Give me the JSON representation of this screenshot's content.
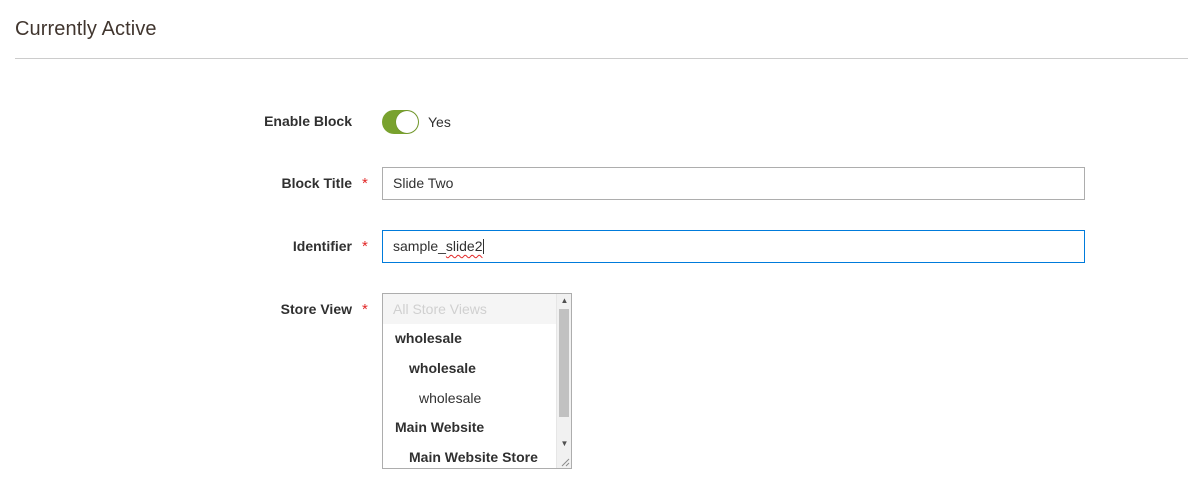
{
  "section": {
    "title": "Currently Active"
  },
  "fields": {
    "enable_block": {
      "label": "Enable Block",
      "value_text": "Yes",
      "enabled": true
    },
    "block_title": {
      "label": "Block Title",
      "required_mark": "*",
      "value": "Slide Two"
    },
    "identifier": {
      "label": "Identifier",
      "required_mark": "*",
      "value_prefix": "sample_",
      "value_misspelled": "slide2"
    },
    "store_view": {
      "label": "Store View",
      "required_mark": "*",
      "options": [
        {
          "label": "All Store Views",
          "disabled": true
        },
        {
          "label": "wholesale"
        },
        {
          "label": "wholesale"
        },
        {
          "label": "wholesale"
        },
        {
          "label": "Main Website"
        },
        {
          "label": "Main Website Store"
        }
      ]
    }
  },
  "colors": {
    "toggle_on": "#79a22e",
    "required": "#e22626",
    "focus_border": "#007bdb"
  },
  "icons": {
    "scroll_up": "scroll-up-arrow-icon",
    "scroll_down": "scroll-down-arrow-icon",
    "resize": "resize-grip-icon"
  }
}
